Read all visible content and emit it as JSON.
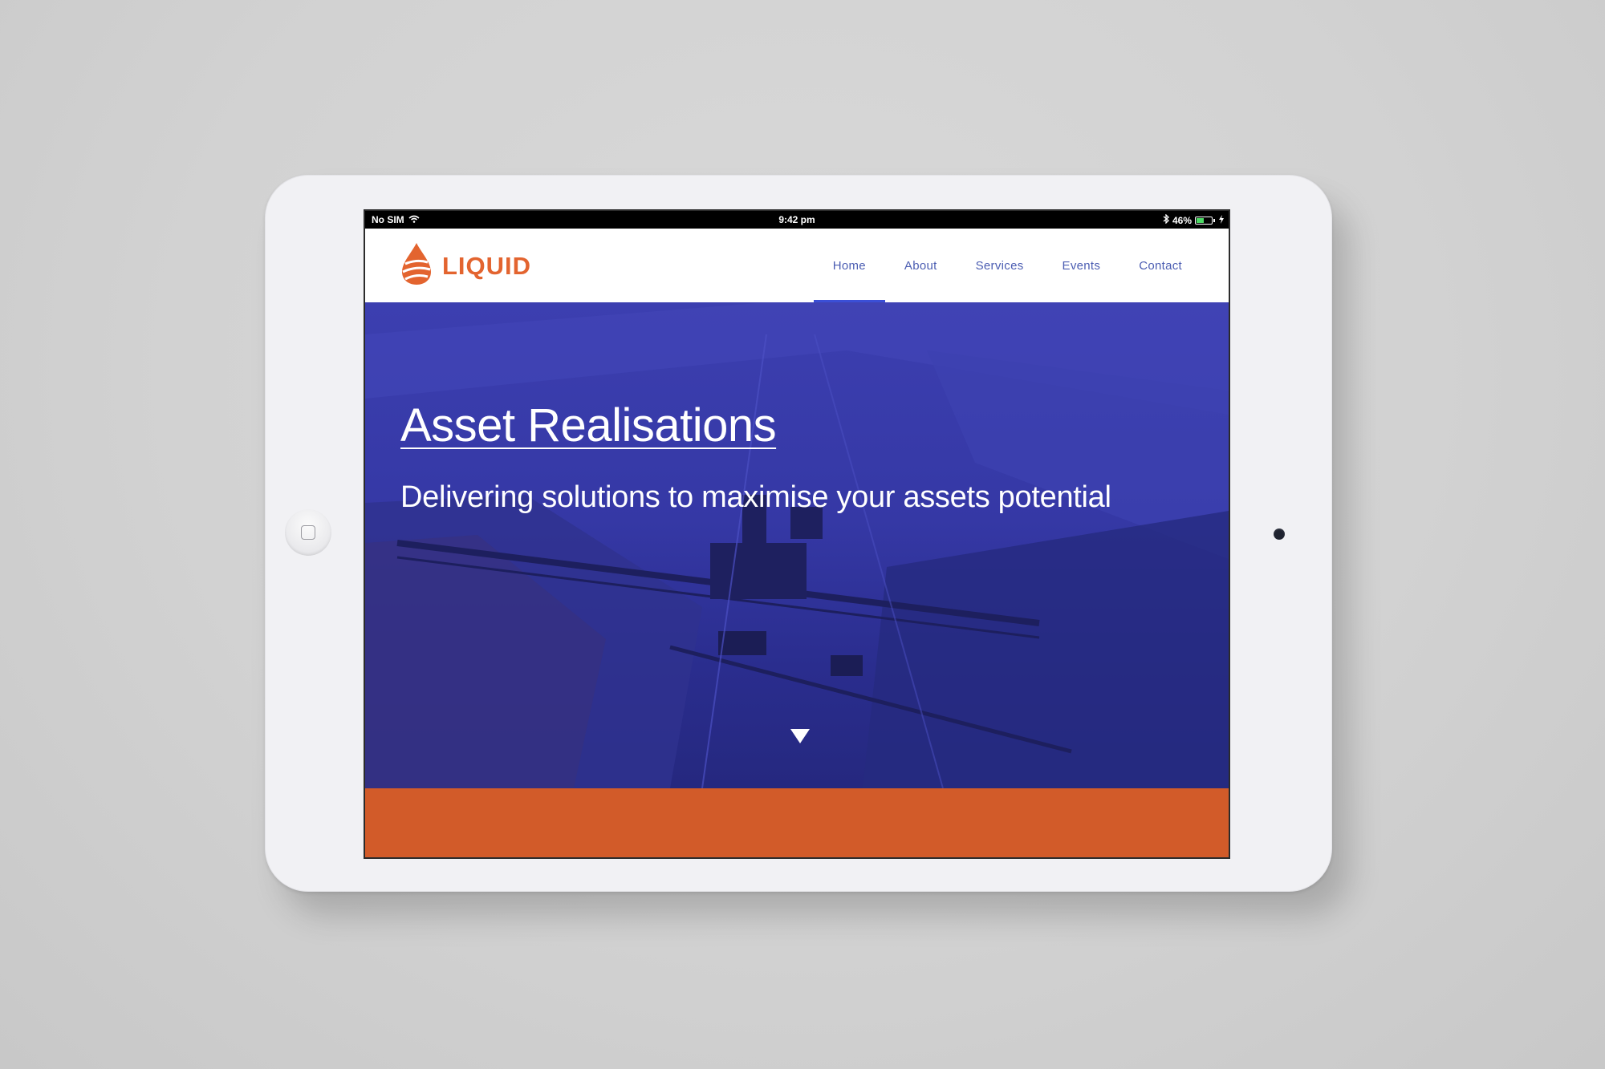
{
  "status_bar": {
    "carrier": "No SIM",
    "time": "9:42 pm",
    "battery": "46%",
    "battery_level": 0.46
  },
  "header": {
    "logo_text": "LIQUID",
    "nav": [
      {
        "label": "Home",
        "active": true
      },
      {
        "label": "About",
        "active": false
      },
      {
        "label": "Services",
        "active": false
      },
      {
        "label": "Events",
        "active": false
      },
      {
        "label": "Contact",
        "active": false
      }
    ]
  },
  "hero": {
    "title": "Asset Realisations",
    "subtitle": "Delivering solutions to maximise your assets potential"
  },
  "colors": {
    "brand_orange": "#e3642f",
    "band_orange": "#d25b29",
    "hero_blue": "#3538a5",
    "nav_text": "#4b5db2",
    "nav_active": "#3b4fd6"
  },
  "icons": [
    "wifi-icon",
    "bluetooth-icon",
    "battery-icon",
    "charging-icon",
    "logo-flame-icon",
    "scroll-down-arrow-icon",
    "home-button-icon"
  ]
}
